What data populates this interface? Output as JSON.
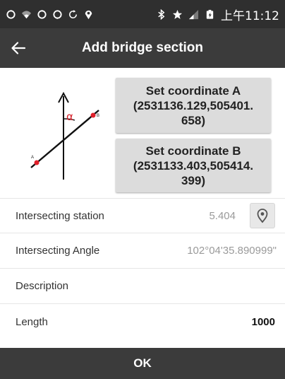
{
  "status_bar": {
    "time": "上午11:12",
    "left_icons": [
      "sync-icon",
      "wifi-icon",
      "sync-icon",
      "sync-icon",
      "refresh-icon",
      "location-icon"
    ],
    "right_icons": [
      "bluetooth-icon",
      "star-icon",
      "signal-icon",
      "battery-icon"
    ]
  },
  "app_bar": {
    "title": "Add bridge section",
    "back_icon": "arrow-left-icon"
  },
  "diagram": {
    "angle_symbol": "α",
    "point_a": "A",
    "point_b": "B"
  },
  "buttons": {
    "coord_a_line1": "Set coordinate A",
    "coord_a_line2": "(2531136.129,505401.",
    "coord_a_line3": "658)",
    "coord_b_line1": "Set coordinate B",
    "coord_b_line2": "(2531133.403,505414.",
    "coord_b_line3": "399)",
    "ok": "OK"
  },
  "form": {
    "station_label": "Intersecting station",
    "station_value": "5.404",
    "angle_label": "Intersecting Angle",
    "angle_value": "102°04'35.890999\"",
    "description_label": "Description",
    "description_value": "",
    "length_label": "Length",
    "length_value": "1000"
  },
  "colors": {
    "bar": "#3b3b3b",
    "status": "#2f2f2f",
    "button": "#dcdcdc",
    "marker": "#e0202a"
  }
}
